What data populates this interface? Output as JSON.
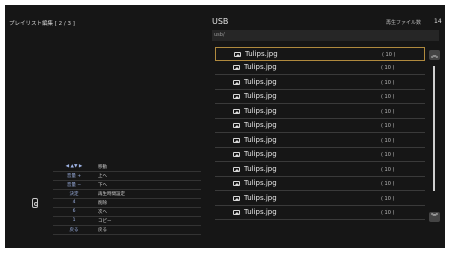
{
  "header": {
    "left_title": "プレイリスト編集 [ 2 / 3 ]",
    "usb_title": "USB",
    "count_label": "再生ファイル数",
    "count_value": "14",
    "path": "usb/"
  },
  "files": [
    {
      "name": "Tulips.jpg",
      "count": "( 10 )",
      "selected": true
    },
    {
      "name": "Tulips.jpg",
      "count": "( 10 )"
    },
    {
      "name": "Tulips.jpg",
      "count": "( 10 )"
    },
    {
      "name": "Tulips.jpg",
      "count": "( 10 )"
    },
    {
      "name": "Tulips.jpg",
      "count": "( 10 )"
    },
    {
      "name": "Tulips.jpg",
      "count": "( 10 )"
    },
    {
      "name": "Tulips.jpg",
      "count": "( 10 )"
    },
    {
      "name": "Tulips.jpg",
      "count": "( 10 )"
    },
    {
      "name": "Tulips.jpg",
      "count": "( 10 )"
    },
    {
      "name": "Tulips.jpg",
      "count": "( 10 )"
    },
    {
      "name": "Tulips.jpg",
      "count": "( 10 )"
    },
    {
      "name": "Tulips.jpg",
      "count": "( 10 )"
    }
  ],
  "scroll": {
    "up_icon": "double-chevron-up-icon",
    "down_icon": "double-chevron-down-icon"
  },
  "help": [
    {
      "key": "◀ ▲▼ ▶",
      "desc": "移動"
    },
    {
      "key": "音量 +",
      "desc": "上へ"
    },
    {
      "key": "音量 −",
      "desc": "下へ"
    },
    {
      "key": "決定",
      "desc": "再生時間設定"
    },
    {
      "key": "4",
      "desc": "削除"
    },
    {
      "key": "6",
      "desc": "次へ"
    },
    {
      "key": "1",
      "desc": "コピー"
    },
    {
      "key": "戻る",
      "desc": "戻る"
    }
  ],
  "colors": {
    "background": "#161616",
    "selection_border": "#b08a3e",
    "key_text": "#9fb4e6"
  }
}
